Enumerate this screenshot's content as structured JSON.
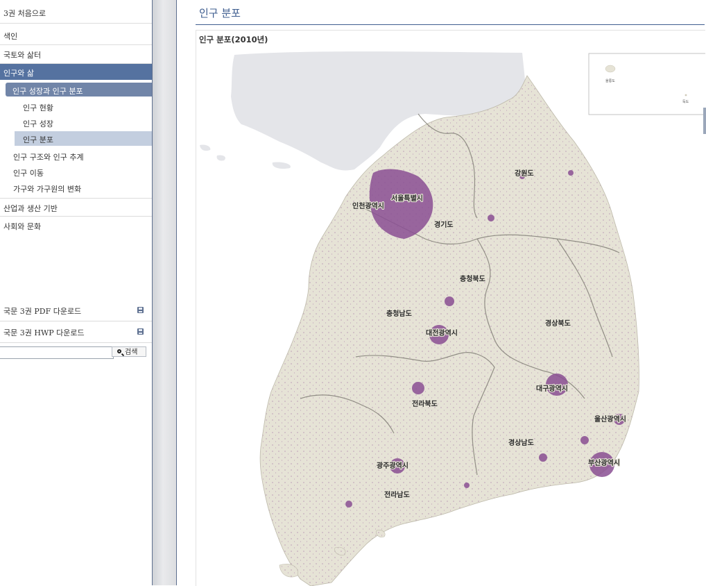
{
  "sidebar": {
    "book_home": "3권 처음으로",
    "items": [
      {
        "label": "색인"
      },
      {
        "label": "국토와 삶터"
      },
      {
        "label": "인구와 삶"
      },
      {
        "label": "인구 성장과 인구 분포"
      },
      {
        "label": "인구 현황"
      },
      {
        "label": "인구 성장"
      },
      {
        "label": "인구 분포"
      },
      {
        "label": "인구 구조와 인구 추계"
      },
      {
        "label": "인구 이동"
      },
      {
        "label": "가구와 가구원의 변화"
      },
      {
        "label": "산업과 생산 기반"
      },
      {
        "label": "사회와 문화"
      }
    ],
    "downloads": [
      {
        "label": "국문 3권 PDF 다운로드",
        "icon": "save-icon"
      },
      {
        "label": "국문 3권 HWP 다운로드",
        "icon": "save-icon"
      }
    ],
    "search": {
      "value": "",
      "button_label": "검색"
    }
  },
  "main": {
    "page_title": "인구 분포",
    "figure_caption": "인구 분포(2010년)",
    "inset_labels": {
      "ulleungdo": "울릉도",
      "dokdo": "독도"
    },
    "region_labels": {
      "seoul": "서울특별시",
      "incheon": "인천광역시",
      "gyeonggi": "경기도",
      "gangwon": "강원도",
      "chungbuk": "충청북도",
      "chungnam": "충청남도",
      "daejeon": "대전광역시",
      "gyeongbuk": "경상북도",
      "daegu": "대구광역시",
      "jeonbuk": "전라북도",
      "ulsan": "울산광역시",
      "gyeongnam": "경상남도",
      "gwangju": "광주광역시",
      "busan": "부산광역시",
      "jeonnam": "전라남도"
    }
  },
  "colors": {
    "accent": "#5572a0",
    "land": "#e6e3d6",
    "population": "#8a4f93",
    "north": "#e4e5e9",
    "title": "#3e5d8f"
  }
}
